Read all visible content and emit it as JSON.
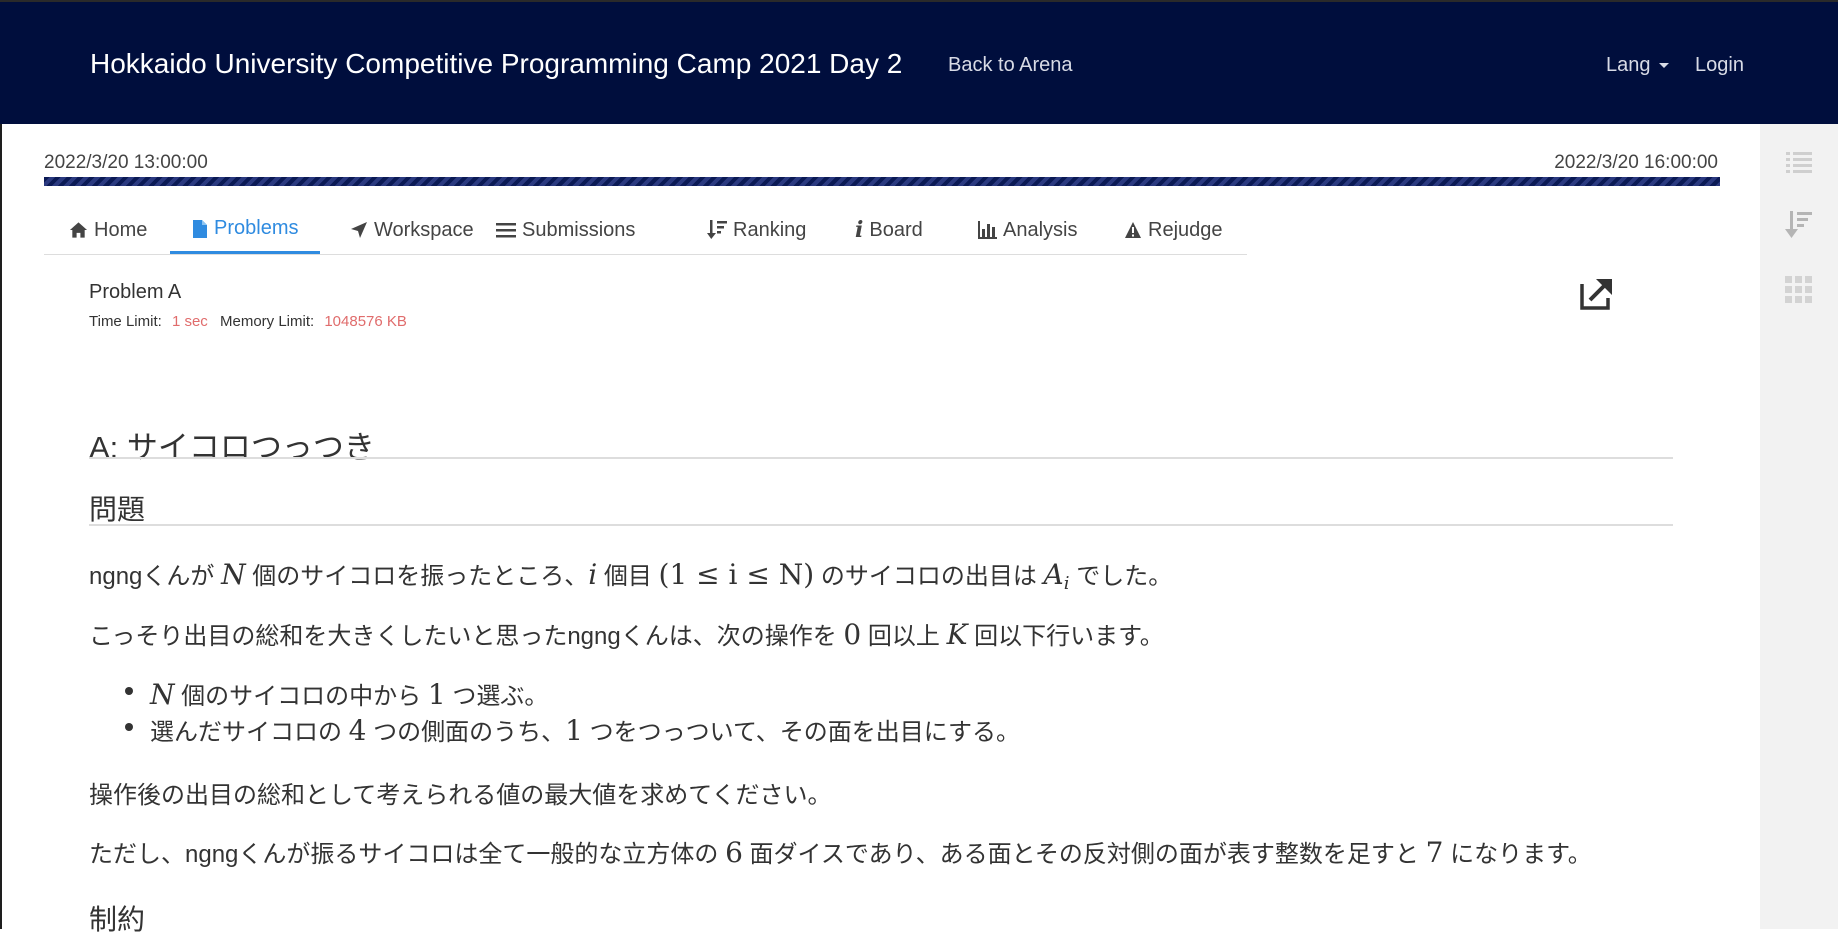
{
  "header": {
    "title": "Hokkaido University Competitive Programming Camp 2021 Day 2",
    "back_link": "Back to Arena",
    "lang": "Lang",
    "login": "Login"
  },
  "contest": {
    "start": "2022/3/20 13:00:00",
    "end": "2022/3/20 16:00:00",
    "progress": 1.0
  },
  "tabs": [
    {
      "label": "Home",
      "icon": "home-icon"
    },
    {
      "label": "Problems",
      "icon": "file-icon",
      "active": true
    },
    {
      "label": "Workspace",
      "icon": "send-icon"
    },
    {
      "label": "Submissions",
      "icon": "list-icon"
    },
    {
      "label": "Ranking",
      "icon": "sort-icon"
    },
    {
      "label": "Board",
      "icon": "info-icon"
    },
    {
      "label": "Analysis",
      "icon": "bar-chart-icon"
    },
    {
      "label": "Rejudge",
      "icon": "warning-icon"
    }
  ],
  "sidebar_icons": [
    "list-icon",
    "sort-down-icon",
    "grid-icon"
  ],
  "problem": {
    "name": "Problem A",
    "time_limit_label": "Time Limit:",
    "time_limit": "1 sec",
    "memory_limit_label": "Memory Limit:",
    "memory_limit": "1048576 KB",
    "title": "A: サイコロつっつき",
    "section_problem": "問題",
    "section_constraints": "制約",
    "p1": {
      "a": "ngngくんが ",
      "N": "N",
      "b": " 個のサイコロを振ったところ、",
      "i": "i",
      "c": " 個目 ",
      "cond": "(1 ≤ i ≤ N)",
      "d": " のサイコロの出目は ",
      "A": "A",
      "Asub": "i",
      "e": " でした。"
    },
    "p2": {
      "a": "こっそり出目の総和を大きくしたいと思ったngngくんは、次の操作を ",
      "zero": "0",
      "b": " 回以上 ",
      "K": "K",
      "c": " 回以下行います。"
    },
    "li1": {
      "N": "N",
      "a": " 個のサイコロの中から ",
      "one": "1",
      "b": " つ選ぶ。"
    },
    "li2": {
      "a": "選んだサイコロの ",
      "four": "4",
      "b": " つの側面のうち、",
      "one": "1",
      "c": " つをつっついて、その面を出目にする。"
    },
    "p3": "操作後の出目の総和として考えられる値の最大値を求めてください。",
    "p4": {
      "a": "ただし、ngngくんが振るサイコロは全て一般的な立方体の ",
      "six": "6",
      "b": " 面ダイスであり、ある面とその反対側の面が表す整数を足すと ",
      "seven": "7",
      "c": " になります。"
    }
  },
  "colors": {
    "header_bg": "#000e3d",
    "active_tab": "#2f8be0",
    "limit_value": "#e06c6c"
  }
}
